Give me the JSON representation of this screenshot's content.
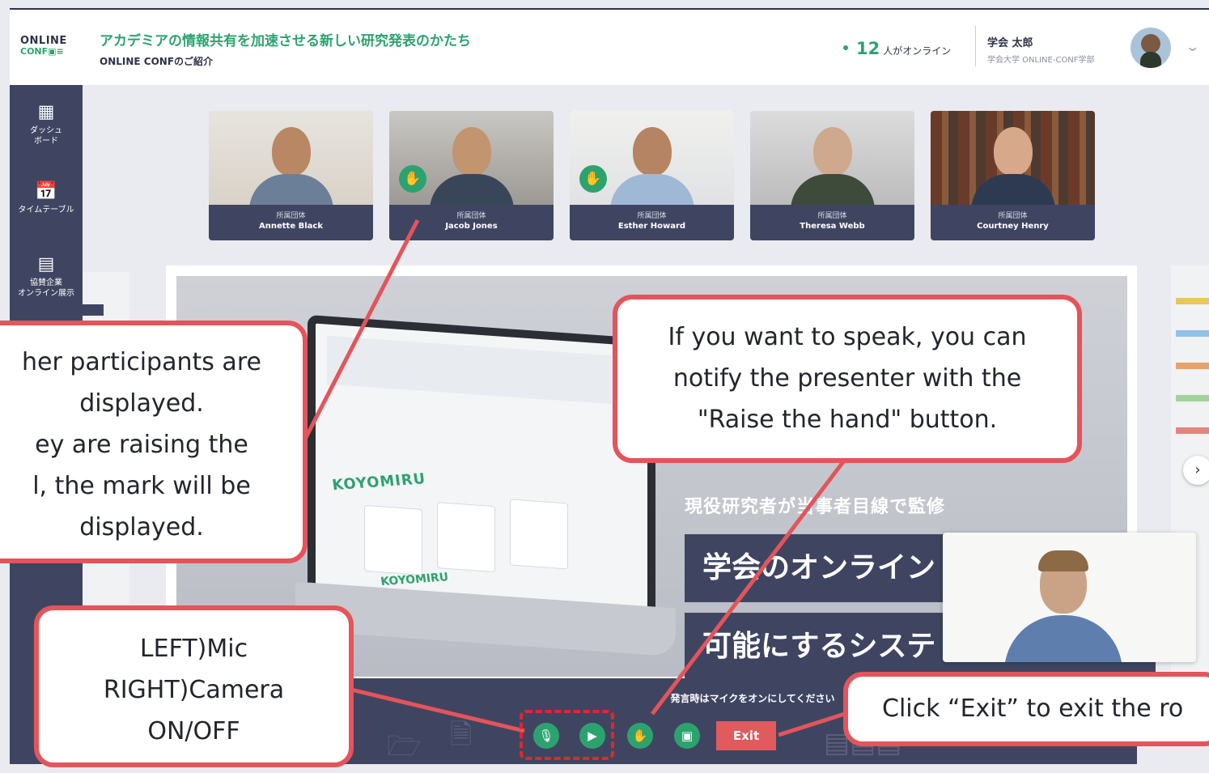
{
  "header": {
    "logo_line1": "ONLINE",
    "logo_line2": "CONF",
    "title": "アカデミアの情報共有を加速させる新しい研究発表のかたち",
    "subtitle": "ONLINE CONFのご紹介",
    "online_count": "12",
    "online_label": "人がオンライン",
    "user_name": "学会 太郎",
    "user_affiliation": "学会大学 ONLINE-CONF学部"
  },
  "sidebar": {
    "items": [
      {
        "icon": "dashboard-grid-icon",
        "label_line1": "ダッシュ",
        "label_line2": "ボード"
      },
      {
        "icon": "calendar-icon",
        "label_line1": "タイムテーブル",
        "label_line2": ""
      },
      {
        "icon": "booth-icon",
        "label_line1": "協賛企業",
        "label_line2": "オンライン展示"
      }
    ]
  },
  "participants": [
    {
      "affiliation": "所属団体",
      "name": "Annette Black",
      "hand_raised": false
    },
    {
      "affiliation": "所属団体",
      "name": "Jacob Jones",
      "hand_raised": true
    },
    {
      "affiliation": "所属団体",
      "name": "Esther Howard",
      "hand_raised": true
    },
    {
      "affiliation": "所属団体",
      "name": "Theresa Webb",
      "hand_raised": false
    },
    {
      "affiliation": "所属団体",
      "name": "Courtney Henry",
      "hand_raised": false
    }
  ],
  "slide": {
    "logo_text_left": "KOYOMIRU",
    "logo_text_left2": "KOYOMIRU",
    "subtitle": "現役研究者が当事者目線で監修",
    "box1": "学会のオンライン",
    "box2": "可能にするシステ"
  },
  "controls": {
    "hint": "発言時はマイクをオンにしてください",
    "mic_icon": "mic-icon",
    "camera_icon": "camera-icon",
    "raise_hand_icon": "raise-hand-icon",
    "share_icon": "screen-share-icon",
    "exit_label": "Exit"
  },
  "annotations": {
    "participants_note": [
      "her participants are",
      "displayed.",
      "ey are raising the",
      "l, the mark will be",
      "displayed."
    ],
    "raise_hand_note": [
      "If you want to speak, you can",
      "notify the presenter with the",
      "\"Raise the hand\" button."
    ],
    "mic_camera_note": [
      "LEFT)Mic",
      "RIGHT)Camera",
      "ON/OFF"
    ],
    "exit_note": "Click “Exit” to exit the ro"
  },
  "colors": {
    "brand_green": "#2ca36f",
    "navy": "#3f4561",
    "callout_red": "#e4545b",
    "exit_red": "#e05a5e"
  }
}
